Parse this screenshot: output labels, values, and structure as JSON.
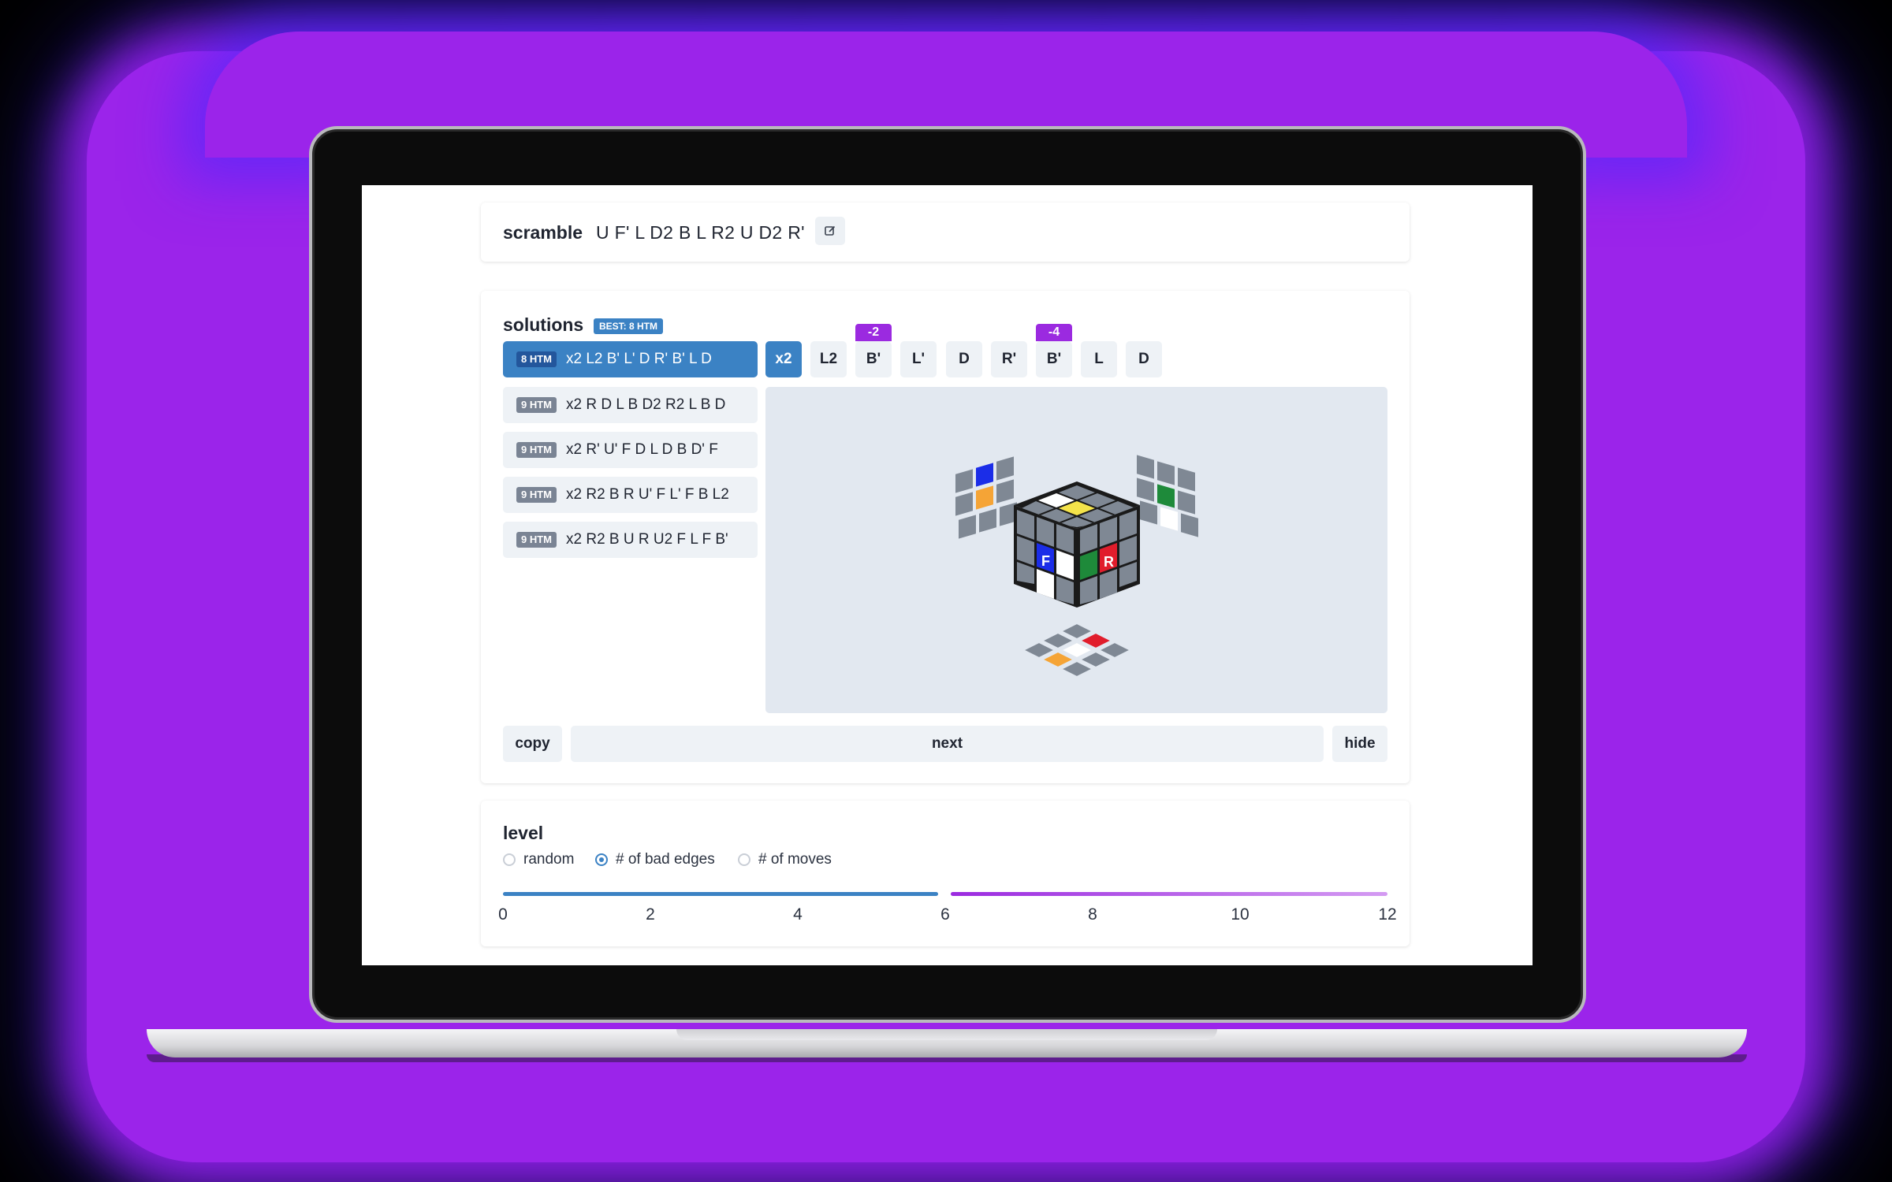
{
  "scramble": {
    "title": "scramble",
    "moves": "U F' L D2 B L R2 U D2 R'"
  },
  "solutions": {
    "title": "solutions",
    "best_badge": "BEST: 8 HTM",
    "items": [
      {
        "htm": "8 HTM",
        "moves": "x2 L2 B' L' D R' B' L D",
        "active": true
      },
      {
        "htm": "9 HTM",
        "moves": "x2 R D L B D2 R2 L B D"
      },
      {
        "htm": "9 HTM",
        "moves": "x2 R' U' F D L D B D' F"
      },
      {
        "htm": "9 HTM",
        "moves": "x2 R2 B R U' F L' F B L2"
      },
      {
        "htm": "9 HTM",
        "moves": "x2 R2 B U R U2 F L F B'"
      }
    ],
    "steps": [
      "x2",
      "L2",
      "B'",
      "L'",
      "D",
      "R'",
      "B'",
      "L",
      "D"
    ],
    "deltas": [
      {
        "step": 2,
        "label": "-2"
      },
      {
        "step": 6,
        "label": "-4"
      }
    ],
    "cube_face_labels": {
      "front": "F",
      "right": "R"
    },
    "copy_label": "copy",
    "next_label": "next",
    "hide_label": "hide"
  },
  "level": {
    "title": "level",
    "options": [
      "random",
      "# of bad edges",
      "# of moves"
    ],
    "selected": "# of bad edges",
    "range_value": 6,
    "ticks": [
      "0",
      "2",
      "4",
      "6",
      "8",
      "10",
      "12"
    ]
  },
  "colors": {
    "accent_blue": "#3b82c4",
    "accent_purple": "#9b2ae0",
    "glow": "#9b24ea"
  }
}
